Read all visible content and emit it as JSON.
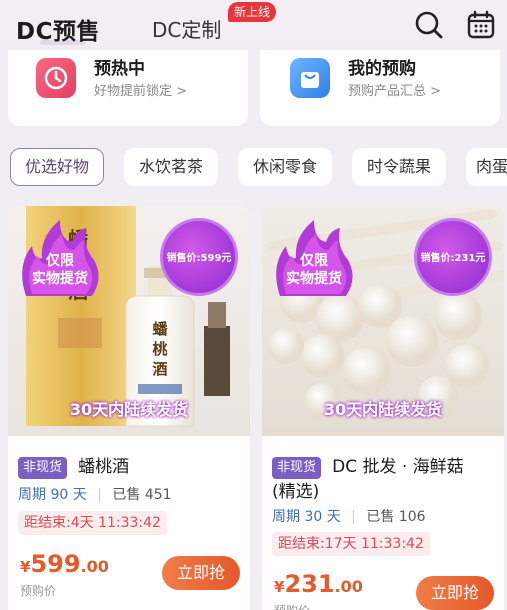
{
  "header": {
    "tabs": [
      {
        "label": "DC预售",
        "active": true
      },
      {
        "label": "DC定制",
        "badge": "新上线"
      }
    ],
    "icons": [
      "search-icon",
      "calendar-icon"
    ]
  },
  "summary_cards": [
    {
      "title": "预热中",
      "subtitle": "好物提前锁定 >",
      "icon": "clock-icon",
      "color": "#f04a6a"
    },
    {
      "title": "我的预购",
      "subtitle": "预购产品汇总 >",
      "icon": "shopping-bag-icon",
      "color": "#3a8ff0"
    }
  ],
  "categories": [
    "优选好物",
    "水饮茗茶",
    "休闲零食",
    "时令蔬果",
    "肉蛋"
  ],
  "active_category": "优选好物",
  "products": [
    {
      "flame_badge_line1": "仅限",
      "flame_badge_line2": "实物提货",
      "circle_price": "销售价:599元",
      "banner": "30天内陆续发货",
      "tag": "非现货",
      "name": "蟠桃酒",
      "period_label": "周期",
      "period_value": "90 天",
      "sold": "已售 451",
      "countdown": "距结束:4天 11:33:42",
      "price_currency": "¥",
      "price_int": "599",
      "price_dec": ".00",
      "price_label": "预购价",
      "buy_label": "立即抢",
      "image_text": "蟠桃酒"
    },
    {
      "flame_badge_line1": "仅限",
      "flame_badge_line2": "实物提货",
      "circle_price": "销售价:231元",
      "banner": "30天内陆续发货",
      "tag": "非现货",
      "name_line1": "DC 批发 · 海鲜菇",
      "name_line2": "(精选)",
      "period_label": "周期",
      "period_value": "30 天",
      "sold": "已售 106",
      "countdown": "距结束:17天 11:33:42",
      "price_currency": "¥",
      "price_int": "231",
      "price_dec": ".00",
      "price_label": "预购价",
      "buy_label": "立即抢"
    }
  ]
}
